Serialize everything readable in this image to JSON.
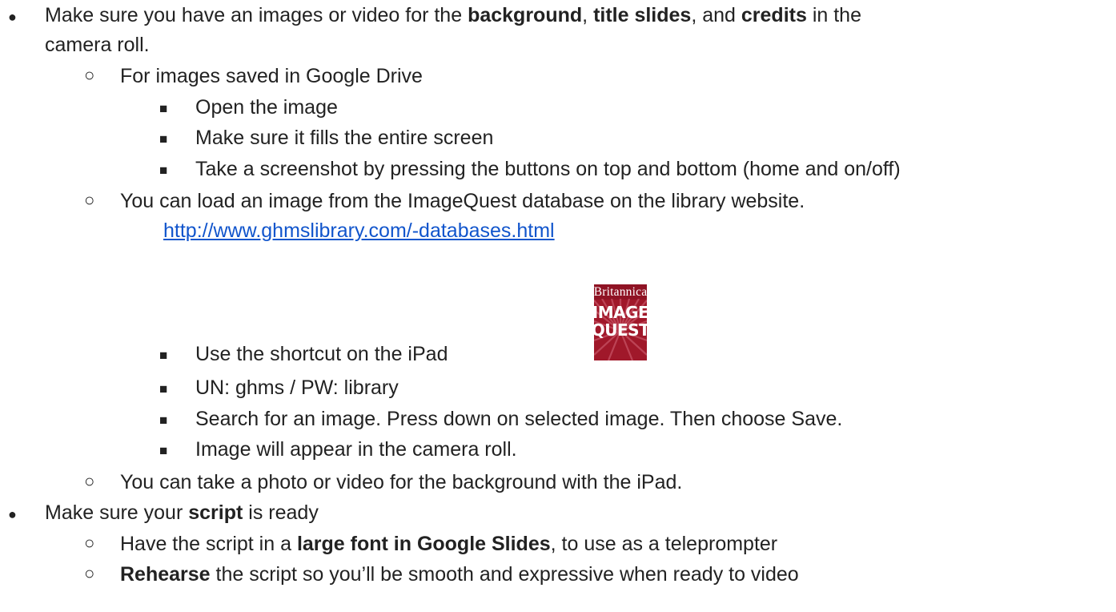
{
  "items": [
    {
      "pre": "Make sure you have an images or video for the ",
      "b1": "background",
      "sep1": ", ",
      "b2": "title slides",
      "sep2": ", and ",
      "b3": "credits",
      "post": " in the",
      "cont": "camera roll."
    },
    {
      "text": "For images saved in Google Drive"
    },
    {
      "text": "Open the image"
    },
    {
      "text": "Make sure it fills the entire screen"
    },
    {
      "text": "Take a screenshot by pressing the buttons on top and bottom (home and on/off)"
    },
    {
      "text": "You can load an image from the ImageQuest database on the library website."
    },
    {
      "link": "http://www.ghmslibrary.com/-databases.html"
    },
    {
      "text": "Use the shortcut on the iPad"
    },
    {
      "text": "UN: ghms / PW: library"
    },
    {
      "text": "Search for an image. Press down on selected image. Then choose Save."
    },
    {
      "text": "Image will appear in the camera roll."
    },
    {
      "text": "You can take a photo or video for the background with the iPad."
    },
    {
      "pre": "Make sure your ",
      "bold": "script",
      "post": " is ready"
    },
    {
      "pre": "Have the script in a ",
      "bold": "large font in Google Slides",
      "post": ", to use as a teleprompter"
    },
    {
      "bold": "Rehearse",
      "post": " the script so you’ll be smooth and expressive when ready to video"
    }
  ],
  "logo": {
    "top": "Britannica",
    "line1": "IMAGE",
    "line2": "QUEST",
    "color": "#a0182a"
  },
  "bullets": {
    "level1": "●",
    "level2": "○",
    "level3": "■"
  }
}
